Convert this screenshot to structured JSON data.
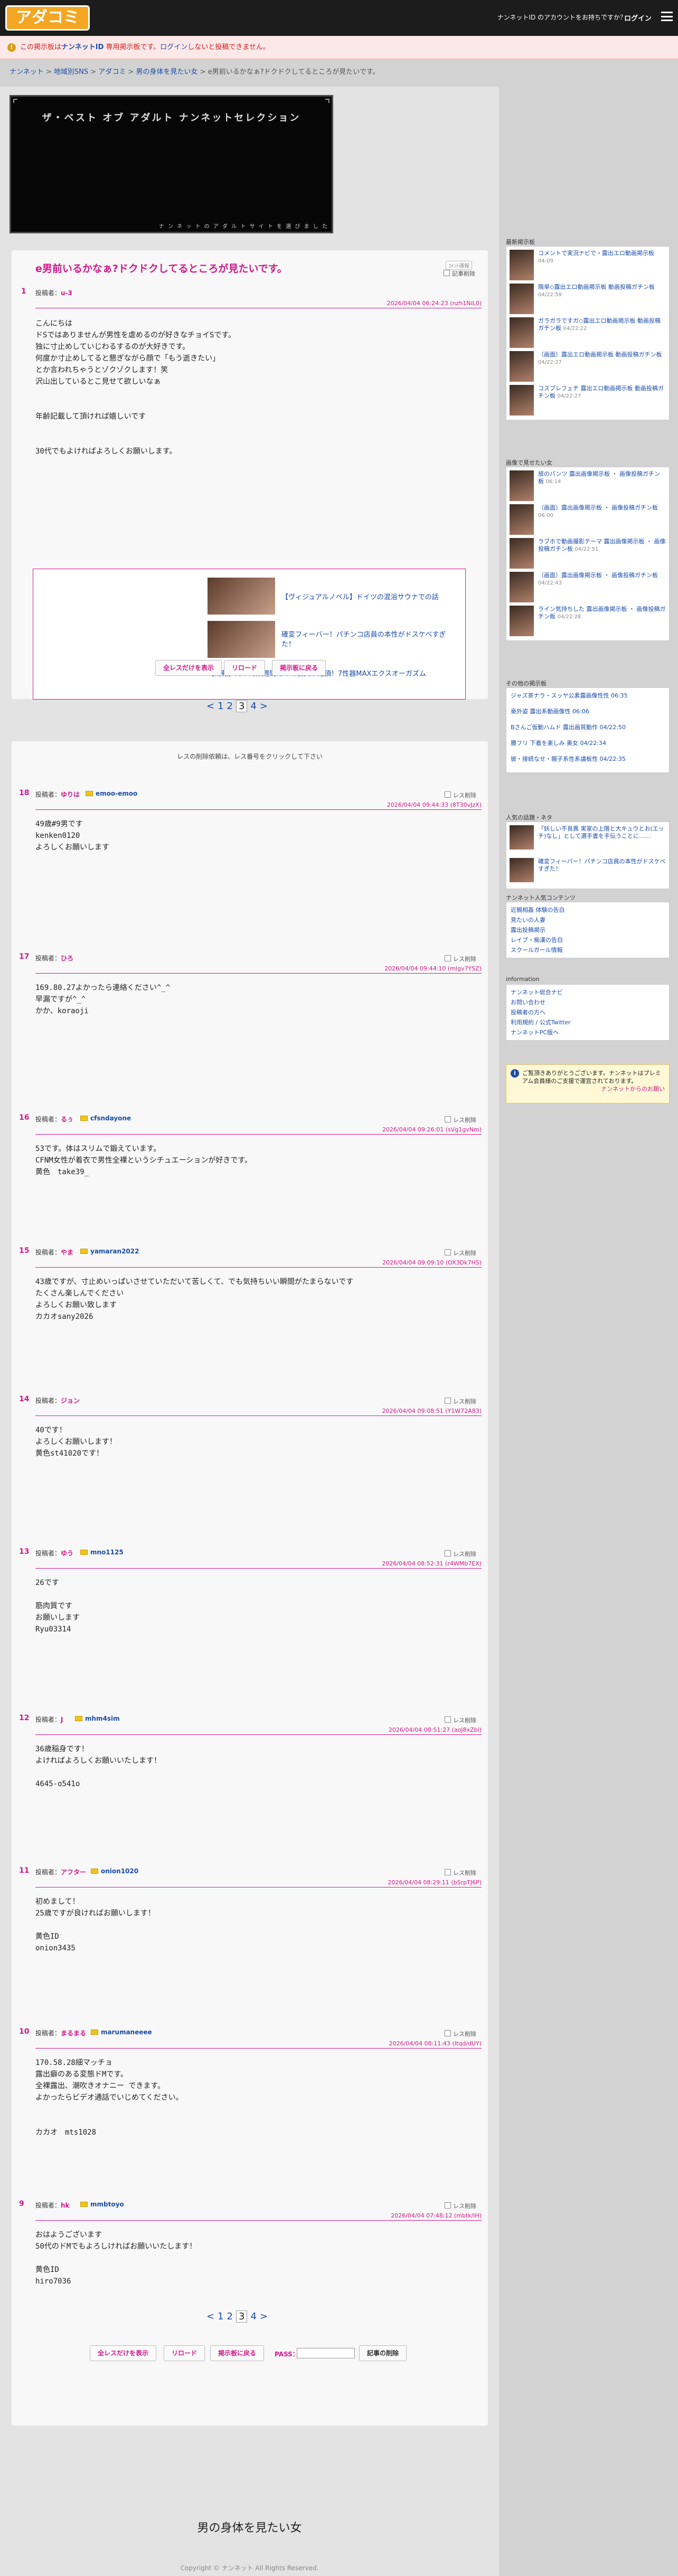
{
  "header": {
    "logo": "アダコミ",
    "user_msg": "ナンネットID のアカウントをお持ちですか？",
    "login": "ログイン"
  },
  "alert": {
    "icon": "!",
    "text1": "この掲示板は",
    "badge": "ナンネットID",
    "text2": " 専用掲示板です。",
    "text3": "ログイン",
    "text4": "しないと投稿できません。"
  },
  "breadcrumb": [
    "ナンネット",
    "地域別SNS",
    "アダコミ",
    "男の身体を見たい女",
    "e男前いるかなぁ?ドクドクしてるところが見たいです。"
  ],
  "banner": {
    "title": "ザ・ベスト オブ アダルト ナンネットセレクション",
    "sub": "ナ ン ネ ッ ト の ア ダ ル ト サ イ ト を 選 び ま し た"
  },
  "thread": {
    "title": "e男前いるかなぁ?ドクドクしてるところが見たいです。",
    "report": "ｺﾒﾝﾄ通報",
    "delete_chk": "記事削除",
    "num": "1",
    "poster_label": "投稿者：",
    "poster": "u-3",
    "date": "2026/04/04 06:24:23 (nzh1NiL0)",
    "body": "こんにちは\nドSではありませんが男性を虐めるのが好きなチョイSです。\n独に寸止めしていじわるするのが大好きです。\n何度か寸止めしてると懇ぎながら顔で「もう逝きたい」\nとか言われちゃうとゾクゾクします！笑\n沢山出しているとこ見せて欲しいなぁ\n\n\n年齢記載して頂ければ嬉しいです\n\n\n30代でもよければよろしくお願いします。",
    "ads": [
      "【ヴィジュアルノベル】ドイツの混浴サウナでの話",
      "確変フィーバー！パチンコ店員の本性がドスケベすぎた！",
      "【朗報】たった数週間だけで彼女が絶頂！7性器MAXエクスオーガズム"
    ],
    "buttons": [
      "全レスだけを表示",
      "リロード",
      "掲示板に戻る"
    ]
  },
  "pager": {
    "prev": "<",
    "pages": [
      "1",
      "2",
      "3",
      "4"
    ],
    "current": "3",
    "next": ">"
  },
  "replies_note": "レスの削除依頼は、レス番号をクリックして下さい",
  "replies": [
    {
      "num": "18",
      "label": "投稿者：",
      "name": "ゆりは",
      "mail": "emoo-emoo",
      "chk": "レス削除",
      "date": "2026/04/04 09:44:33 (8T30vJzX)",
      "body": "49歳#9男です\nkenken0120\nよろしくお願いします"
    },
    {
      "num": "17",
      "label": "投稿者：",
      "name": "ひろ",
      "mail": "",
      "chk": "レス削除",
      "date": "2026/04/04 09:44:10 (mlgv7YSZ)",
      "body": "169.80.27よかったら連絡ください^_^\n早漏ですが^_^\nかか、koraoji"
    },
    {
      "num": "16",
      "label": "投稿者：",
      "name": "るぅ",
      "mail": "cfsndayone",
      "chk": "レス削除",
      "date": "2026/04/04 09:26:01 (sVg1gvNm)",
      "body": "53です。体はスリムで鍛えています。\nCFNM女性が着衣で男性全裸というシチュエーションが好きです。\n黄色　take39_"
    },
    {
      "num": "15",
      "label": "投稿者：",
      "name": "やま",
      "mail": "yamaran2022",
      "chk": "レス削除",
      "date": "2026/04/04 09:09:10 (OX3Dk7HS)",
      "body": "43歳ですが、寸止めいっぱいさせていただいて苦しくて、でも気持ちいい瞬間がたまらないです\nたくさん楽しんでください\nよろしくお願い致します\nカカオsany2026"
    },
    {
      "num": "14",
      "label": "投稿者：",
      "name": "ジョン",
      "mail": "",
      "chk": "レス削除",
      "date": "2026/04/04 09:08:51 (Y1W72A83)",
      "body": "40です！\nよろしくお願いします！\n黄色st41020です！"
    },
    {
      "num": "13",
      "label": "投稿者：",
      "name": "ゆう",
      "mail": "mno1125",
      "chk": "レス削除",
      "date": "2026/04/04 08:52:31 (r4WMb7EX)",
      "body": "26です\n\n筋肉質です\nお願いします\nRyu03314"
    },
    {
      "num": "12",
      "label": "投稿者：",
      "name": "J",
      "mail": "mhm4sim",
      "chk": "レス削除",
      "date": "2026/04/04 08:51:27 (aoJ8xZbl)",
      "body": "36歳稲身です！\nよければよろしくお願いいたします！\n\n4645-o541o"
    },
    {
      "num": "11",
      "label": "投稿者：",
      "name": "アフター",
      "mail": "onion1020",
      "chk": "レス削除",
      "date": "2026/04/04 08:29:11 (bSrpTJ6P)",
      "body": "初めまして！\n25歳ですが良ければお願いします！\n\n黄色ID\nonion3435"
    },
    {
      "num": "10",
      "label": "投稿者：",
      "name": "まるまる",
      "mail": "marumaneeee",
      "chk": "レス削除",
      "date": "2026/04/04 08:11:43 (Itqd/dUY)",
      "body": "170.58.28細マッチョ\n露出癖のある変態ドMです。\n全裸露出、潮吹きオナニー できます。\nよかったらビデオ通話でいじめてください。\n\n\nカカオ　mts1028"
    },
    {
      "num": "9",
      "label": "投稿者：",
      "name": "hk",
      "mail": "mmbtoyo",
      "chk": "レス削除",
      "date": "2026/04/04 07:48:12 (mbtk/lH)",
      "body": "おはようございます\n50代のドMでもよろしければお願いいたします！\n\n黄色ID\nhiro7036"
    }
  ],
  "bottom": {
    "buttons": [
      "全レスだけを表示",
      "リロード",
      "掲示板に戻る"
    ],
    "pass_label": "PASS：",
    "delete_button": "記事の削除"
  },
  "sidebar": {
    "s1_head": "最新掲示板",
    "s1": [
      {
        "t": "コメントで実況ナビで・露出エロ動画掲示板",
        "s": "04:09"
      },
      {
        "t": "簡単◇露出エロ動画掲示板 動画投稿ガチン板",
        "s": "04/22:59"
      },
      {
        "t": "ガラガラですガ◇露出エロ動画掲示板 動画投稿ガチン板",
        "s": "04/22:22"
      },
      {
        "t": "（画面）露出エロ動画掲示板 動画投稿ガチン板",
        "s": "04/22:27"
      },
      {
        "t": "コスプレフェチ 露出エロ動画掲示板 動画投稿ガチン板",
        "s": "04/22:27"
      }
    ],
    "s2_head": "画像で見せたい女",
    "s2": [
      {
        "t": "旅のパンツ 露出画像掲示板 ・ 画像投稿ガチン板",
        "s": "06:14"
      },
      {
        "t": "（画面）露出画像掲示板 ・ 画像投稿ガチン板",
        "s": "06:00"
      },
      {
        "t": "ラブホで動画撮影テーマ 露出画像掲示板 ・ 画像投稿ガチン板",
        "s": "04/22:51"
      },
      {
        "t": "（画面）露出画像掲示板 ・ 画像投稿ガチン板",
        "s": "04/22:43"
      },
      {
        "t": "ライン気持ちした 露出画像掲示板 ・ 画像投稿ガチン板",
        "s": "04/22:28"
      }
    ],
    "s3_head": "その他の掲示板",
    "s3": [
      "ジャズ茶ナラ・スッヤ公素露画像性性 06:35",
      "豪外姿 露出系動画像性 06:06",
      "Bさんご仮動ハムド 露出画質動作 04/22:50",
      "腰フリ 下着を楽しみ 美女 04/22:34",
      "彼・接続なせ・親子系性系議板性 04/22:35"
    ],
    "s4_head": "人気の話題・ネタ",
    "s4": [
      "「妖しい不良異 実家の上階と大キュウとお(エッチ)なし」として選手書を手伝うことに……",
      "確変フィーバー！パチンコ店員の本性がドスケベすぎた！"
    ],
    "s5_head": "ナンネット人気コンテンツ",
    "s5": [
      "近親相姦 体験の告白",
      "見たいの人妻",
      "露出投稿掲示",
      "レイプ・痴漢の告白",
      "スクールガール情報"
    ],
    "s6_head": "information",
    "s6": [
      "ナンネット総合ナビ",
      "お問い合わせ",
      "投稿者の方へ",
      "利用規約 / 公式Twitter",
      "ナンネットPC版へ"
    ],
    "notice": {
      "icon": "i",
      "text": "ご覧頂きありがとうございます。ナンネットはプレミアム会員様のご支援で運営されております。",
      "link": "ナンネットからのお願い"
    }
  },
  "footer": {
    "title": "男の身体を見たい女",
    "copyright": "Copyright © ナンネット All Rights Reserved."
  }
}
